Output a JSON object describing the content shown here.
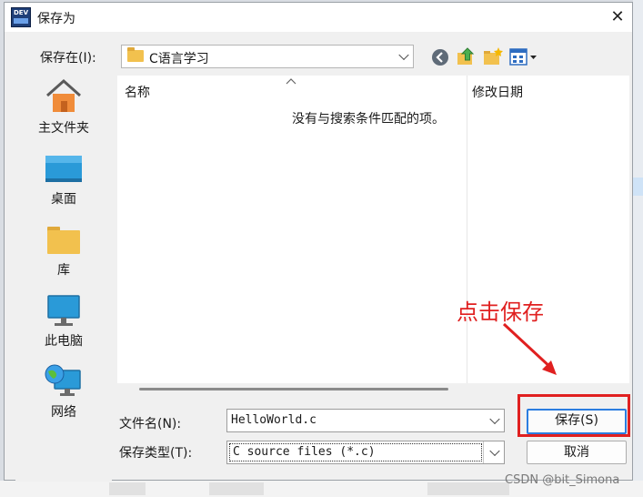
{
  "dialog": {
    "title": "保存为",
    "close_glyph": "✕",
    "app_icon_text": "DEV"
  },
  "location": {
    "label": "保存在(I):",
    "current_folder": "C语言学习"
  },
  "places": [
    {
      "label": "主文件夹",
      "icon": "home-icon"
    },
    {
      "label": "桌面",
      "icon": "desktop-icon"
    },
    {
      "label": "库",
      "icon": "library-folder-icon"
    },
    {
      "label": "此电脑",
      "icon": "computer-monitor-icon"
    },
    {
      "label": "网络",
      "icon": "network-globe-icon"
    }
  ],
  "list": {
    "columns": [
      {
        "label": "名称"
      },
      {
        "label": "修改日期"
      }
    ],
    "empty_message": "没有与搜索条件匹配的项。"
  },
  "filename": {
    "label": "文件名(N):",
    "value": "HelloWorld.c"
  },
  "filetype": {
    "label": "保存类型(T):",
    "value": "C source files (*.c)"
  },
  "buttons": {
    "save": "保存(S)",
    "cancel": "取消"
  },
  "annotation": {
    "text": "点击保存",
    "color": "#e02020"
  },
  "watermark": "CSDN @bit_Simona",
  "colors": {
    "default_button_border": "#2b7de0",
    "folder": "#f2c14e"
  }
}
